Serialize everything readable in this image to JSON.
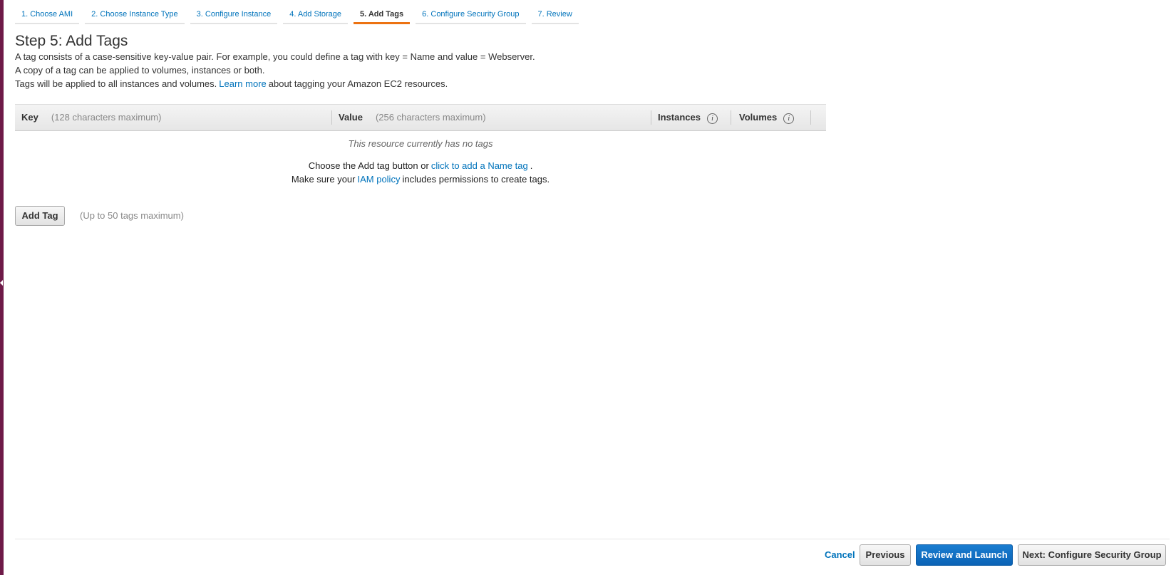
{
  "wizard": {
    "tabs": [
      {
        "label": "1. Choose AMI"
      },
      {
        "label": "2. Choose Instance Type"
      },
      {
        "label": "3. Configure Instance"
      },
      {
        "label": "4. Add Storage"
      },
      {
        "label": "5. Add Tags",
        "active": true
      },
      {
        "label": "6. Configure Security Group"
      },
      {
        "label": "7. Review"
      }
    ],
    "active_color": "#ec7211",
    "link_color": "#0073bb"
  },
  "page": {
    "title": "Step 5: Add Tags",
    "desc_line1": "A tag consists of a case-sensitive key-value pair. For example, you could define a tag with key = Name and value = Webserver.",
    "desc_line2": "A copy of a tag can be applied to volumes, instances or both.",
    "desc_line3_before": "Tags will be applied to all instances and volumes.",
    "desc_line3_link": "Learn more",
    "desc_line3_after": "about tagging your Amazon EC2 resources."
  },
  "tag_table": {
    "columns": {
      "key_label": "Key",
      "key_hint": "(128 characters maximum)",
      "value_label": "Value",
      "value_hint": "(256 characters maximum)",
      "instances_label": "Instances",
      "volumes_label": "Volumes",
      "info_icon": "i"
    },
    "empty_message": "This resource currently has no tags",
    "help_line1_before": "Choose the Add tag button or",
    "help_line1_link": "click to add a Name tag",
    "help_line1_after": ".",
    "help_line2_before": "Make sure your",
    "help_line2_link": "IAM policy",
    "help_line2_after": "includes permissions to create tags."
  },
  "add_tag": {
    "button_label": "Add Tag",
    "hint": "(Up to 50 tags maximum)"
  },
  "footer": {
    "cancel_label": "Cancel",
    "previous_label": "Previous",
    "review_launch_label": "Review and Launch",
    "next_label": "Next: Configure Security Group",
    "primary_color": "#0b63b6"
  }
}
